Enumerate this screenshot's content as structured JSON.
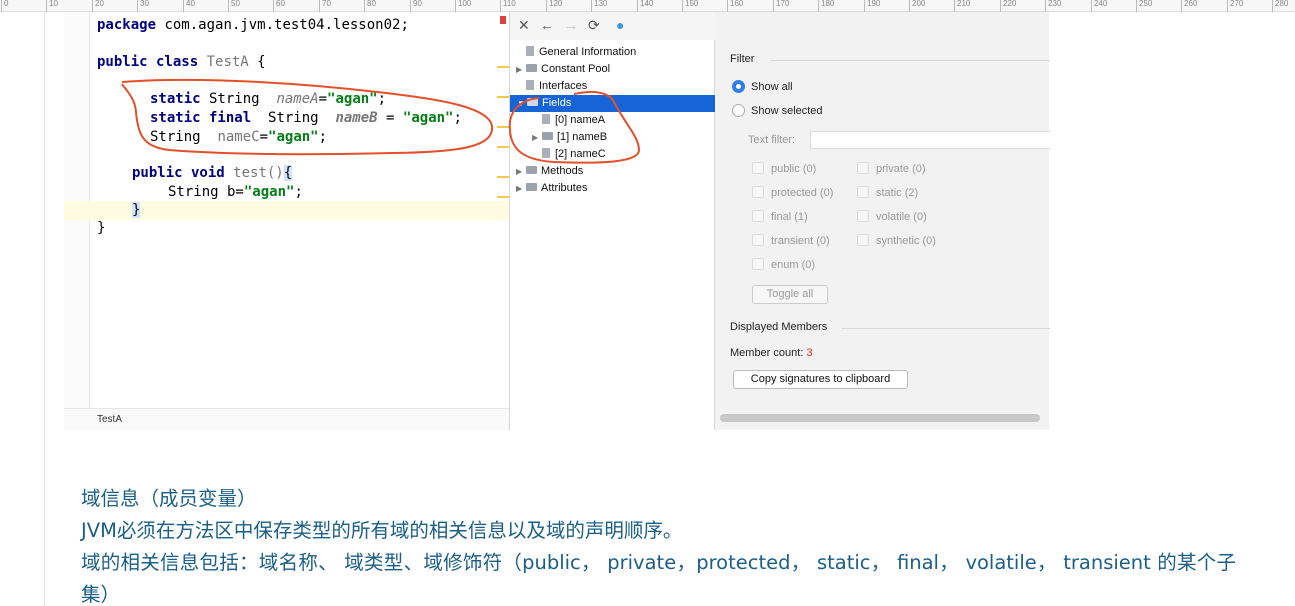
{
  "ruler": {
    "labels": [
      "0",
      "10",
      "20",
      "30",
      "40",
      "50",
      "60",
      "70",
      "80",
      "90",
      "100",
      "110",
      "120",
      "130",
      "140",
      "150",
      "160",
      "170",
      "180",
      "190",
      "200",
      "210",
      "220",
      "230",
      "240",
      "250",
      "260",
      "270",
      "280"
    ]
  },
  "editor": {
    "status_label": "TestA",
    "lines": {
      "package_kw": "package",
      "package_name": " com.agan.jvm.test04.lesson02;",
      "public_kw": "public",
      "class_kw": " class",
      "class_name": " TestA",
      "class_open": " {",
      "static_kw": "static",
      "string_type": " String  ",
      "nameA": "nameA",
      "eq": "=",
      "agan": "\"agan\"",
      "semi": ";",
      "static_kw2": "static",
      "final_kw": " final",
      "string_type2": "  String  ",
      "nameB": "nameB",
      "eq_spaced": " = ",
      "agan2": "\"agan\"",
      "semi2": ";",
      "string_type3": "String  ",
      "nameC": "nameC",
      "eq3": "=",
      "agan3": "\"agan\"",
      "semi3": ";",
      "public_kw2": "public",
      "void_kw": " void",
      "method_name": " test()",
      "method_open": "{",
      "local_type": "String b=",
      "agan4": "\"agan\"",
      "semi4": ";",
      "method_close": "}",
      "class_close": "}"
    }
  },
  "viewer": {
    "toolbar": {
      "close": "✕",
      "back": "←",
      "forward": "→",
      "refresh": "⟳",
      "globe": "●"
    },
    "tree": {
      "general": "General Information",
      "constant_pool": "Constant Pool",
      "interfaces": "Interfaces",
      "fields": "Fields",
      "field0": "[0] nameA",
      "field1": "[1] nameB",
      "field2": "[2] nameC",
      "methods": "Methods",
      "attributes": "Attributes"
    },
    "panel": {
      "filter_title": "Filter",
      "show_all": "Show all",
      "show_selected": "Show selected",
      "text_filter": "Text filter:",
      "checkboxes": {
        "public": "public (0)",
        "private": "private (0)",
        "protected": "protected (0)",
        "static": "static (2)",
        "final": "final (1)",
        "volatile": "volatile (0)",
        "transient": "transient (0)",
        "synthetic": "synthetic (0)",
        "enum": "enum (0)"
      },
      "toggle_all": "Toggle all",
      "displayed_members": "Displayed Members",
      "member_count_label": "Member count:",
      "member_count_value": "3",
      "copy_button": "Copy signatures to clipboard"
    }
  },
  "notes": {
    "line1": "域信息（成员变量）",
    "line2": "JVM必须在方法区中保存类型的所有域的相关信息以及域的声明顺序。",
    "line3": "域的相关信息包括：域名称、 域类型、域修饰符（public， private，protected， static， final， volatile， transient 的某个子集）"
  },
  "colors": {
    "keyword": "#000080",
    "string": "#067d17",
    "selection": "#1764d6",
    "annotation": "#e3502a",
    "note_text": "#1b5f87"
  }
}
